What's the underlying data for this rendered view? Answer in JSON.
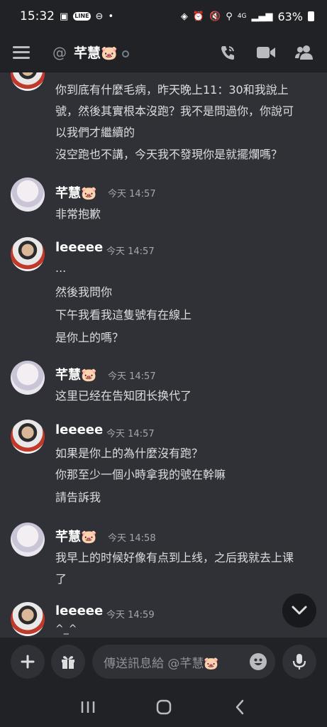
{
  "status_bar": {
    "time": "15:32",
    "battery": "63%",
    "network": "4G"
  },
  "header": {
    "at_symbol": "@",
    "channel_name": "芊慧🐷"
  },
  "messages": [
    {
      "id": "m0",
      "lines": [
        "你到底有什麼毛病，昨天晚上11：30和我說上",
        "號，然後其實根本沒跑？我不是問過你，你說可",
        "以我們才繼續的",
        "沒空跑也不講，今天我不發現你是就擺爛嗎？"
      ]
    },
    {
      "id": "m1",
      "user": "芊慧🐷",
      "time": "今天 14:57",
      "lines": [
        "非常抱歉"
      ]
    },
    {
      "id": "m2",
      "user": "leeeee",
      "time": "今天 14:57",
      "lines": [
        "...",
        "然後我問你",
        "下午我看我這隻號有在線上",
        "是你上的嗎？"
      ]
    },
    {
      "id": "m3",
      "user": "芊慧🐷",
      "time": "今天 14:57",
      "lines": [
        "这里已经在告知团长换代了"
      ]
    },
    {
      "id": "m4",
      "user": "leeeee",
      "time": "今天 14:57",
      "lines": [
        "如果是你上的為什麼沒有跑？",
        "你那至少一個小時拿我的號在幹嘛",
        "請告訴我"
      ]
    },
    {
      "id": "m5",
      "user": "芊慧🐷",
      "time": "今天 14:58",
      "lines": [
        "我早上的时候好像有点到上线，之后我就去上课",
        "了"
      ]
    },
    {
      "id": "m6",
      "user": "leeeee",
      "time": "今天 14:59",
      "lines": [
        "^_^"
      ]
    }
  ],
  "composer": {
    "placeholder": "傳送訊息給 @芊慧🐷"
  },
  "colors": {
    "background": "#2f3136",
    "bar": "#202225",
    "text": "#dcddde",
    "muted": "#a3a6aa"
  },
  "icons": [
    "menu-icon",
    "voice-call-icon",
    "video-call-icon",
    "members-icon",
    "plus-icon",
    "gift-icon",
    "emoji-icon",
    "microphone-icon",
    "chevron-down-icon",
    "recents-icon",
    "home-icon",
    "back-icon"
  ]
}
